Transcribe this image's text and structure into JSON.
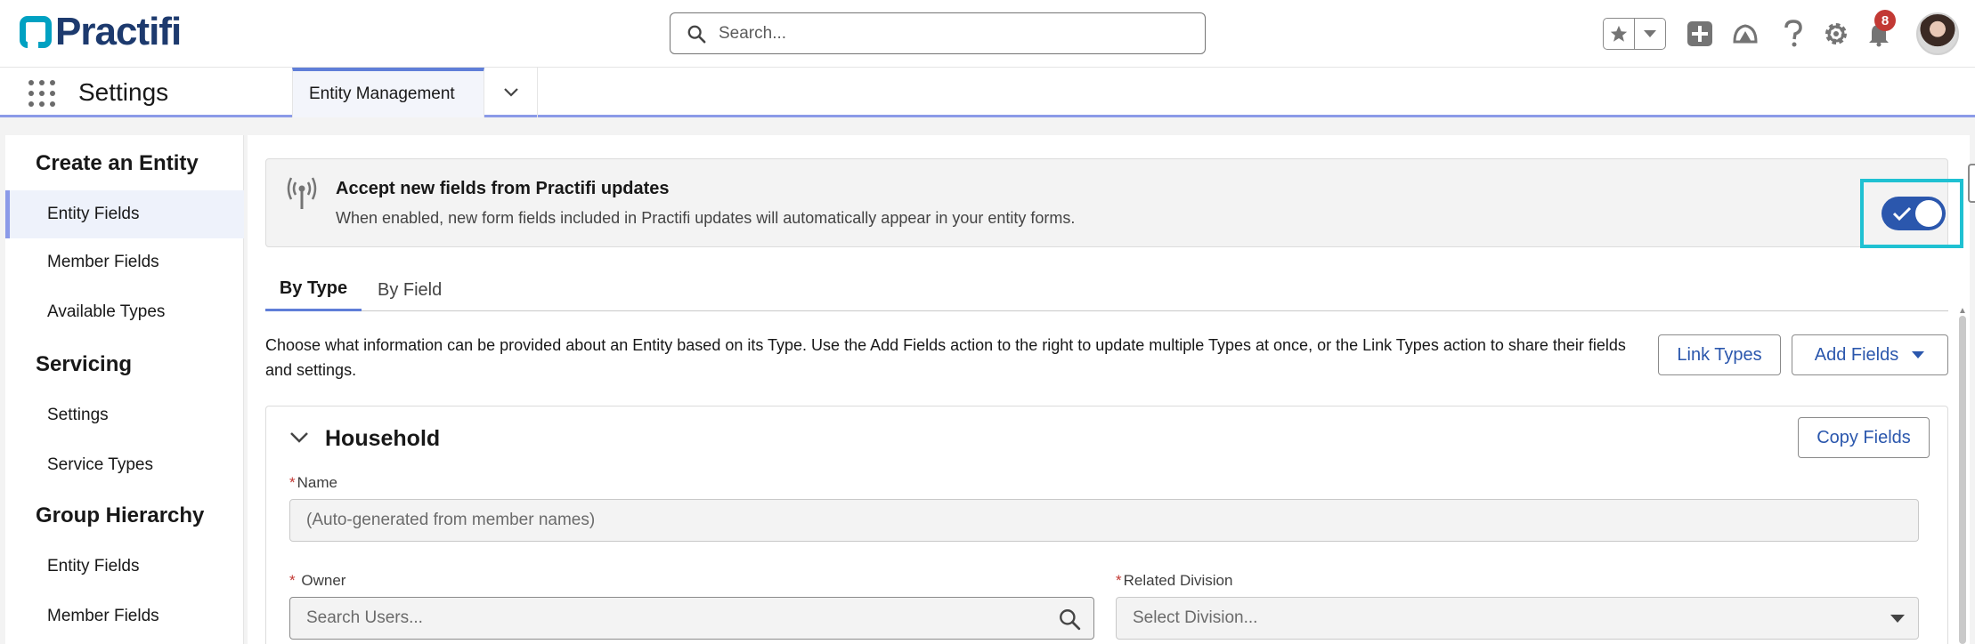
{
  "header": {
    "logo_text": "Practifi",
    "search_placeholder": "Search...",
    "notification_count": "8",
    "icons": [
      "star-icon",
      "chevron-down-icon",
      "plus-icon",
      "trailhead-icon",
      "help-icon",
      "gear-icon",
      "bell-icon"
    ]
  },
  "nav": {
    "app_name": "Settings",
    "active_tab": "Entity Management"
  },
  "sidebar": {
    "sections": [
      {
        "title": "Create an Entity",
        "items": [
          "Entity Fields",
          "Member Fields",
          "Available Types"
        ]
      },
      {
        "title": "Servicing",
        "items": [
          "Settings",
          "Service Types"
        ]
      },
      {
        "title": "Group Hierarchy",
        "items": [
          "Entity Fields",
          "Member Fields"
        ]
      }
    ],
    "active_item": "Entity Fields"
  },
  "banner": {
    "title": "Accept new fields from Practifi updates",
    "description": "When enabled, new form fields included in Practifi updates will automatically appear in your entity forms.",
    "toggle_on": true
  },
  "tabs": {
    "by_type": "By Type",
    "by_field": "By Field",
    "selected": "By Type"
  },
  "intro_text": "Choose what information can be provided about an Entity based on its Type. Use the Add Fields action to the right to update multiple Types at once, or the Link Types action to share their fields and settings.",
  "buttons": {
    "link_types": "Link Types",
    "add_fields": "Add Fields",
    "copy_fields": "Copy Fields"
  },
  "household": {
    "title": "Household",
    "name_label": "Name",
    "name_value": "(Auto-generated from member names)",
    "owner_label": "Owner",
    "owner_placeholder": "Search Users...",
    "division_label": "Related Division",
    "division_placeholder": "Select Division...",
    "required_marker": "*"
  },
  "colors": {
    "brand": "#1d3a6e",
    "accent": "#2b57ad",
    "toggle_highlight": "#1fc1d2",
    "nav_indicator": "#8b9ae8"
  }
}
